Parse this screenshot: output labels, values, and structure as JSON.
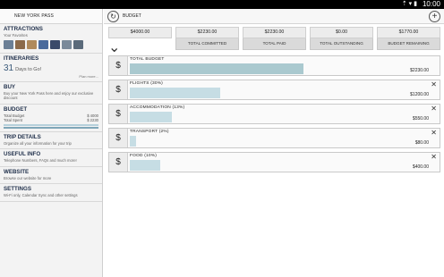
{
  "status": {
    "time": "10:00",
    "icons": "⇡ ▾ ▮"
  },
  "sidebar": {
    "header": "NEW YORK PASS",
    "attractions": {
      "title": "ATTRACTIONS",
      "sub": "Your Favorites"
    },
    "thumb_colors": [
      "#6b7f96",
      "#8c6a4a",
      "#b08a5c",
      "#4a6a9c",
      "#3a4a6a",
      "#7a8a9a",
      "#5a6a7a"
    ],
    "itineraries": {
      "title": "ITINERARIES",
      "days_num": "31",
      "days_text": "Days to Go!",
      "plan_more": "Plan more..."
    },
    "buy": {
      "title": "BUY",
      "sub": "Buy your New York Pass here and enjoy our exclusive discount"
    },
    "budget": {
      "title": "BUDGET",
      "total_budget_label": "Total Budget",
      "total_budget_value": "$ 4000",
      "total_spent_label": "Total Spent",
      "total_spent_value": "$ 2230"
    },
    "trip_details": {
      "title": "TRIP DETAILS",
      "sub": "Organize all your information for your trip"
    },
    "useful_info": {
      "title": "USEFUL INFO",
      "sub": "Telephone Numbers, FAQs and much more!"
    },
    "website": {
      "title": "WEBSITE",
      "sub": "Browse our website for more"
    },
    "settings": {
      "title": "SETTINGS",
      "sub": "Wi-Fi only, Calendar Sync and other settings"
    }
  },
  "topbar": {
    "title": "BUDGET",
    "back_icon": "back-icon",
    "add_icon": "add-icon"
  },
  "summary": [
    {
      "value": "$4000.00",
      "label": "TOTAL BUDGET",
      "dropdown": true
    },
    {
      "value": "$2230.00",
      "label": "TOTAL COMMITTED"
    },
    {
      "value": "$2230.00",
      "label": "TOTAL PAID"
    },
    {
      "value": "$0.00",
      "label": "TOTAL OUTSTANDING"
    },
    {
      "value": "$1770.00",
      "label": "BUDGET REMAINING"
    }
  ],
  "rows": [
    {
      "name": "TOTAL BUDGET",
      "amount": "$2230.00",
      "fraction": 0.575,
      "deletable": false,
      "total": true
    },
    {
      "name": "FLIGHTS  (30%)",
      "amount": "$1200.00",
      "fraction": 0.3,
      "deletable": true
    },
    {
      "name": "ACCOMMODATION  (13%)",
      "amount": "$550.00",
      "fraction": 0.14,
      "deletable": true
    },
    {
      "name": "TRANSPORT  (2%)",
      "amount": "$80.00",
      "fraction": 0.02,
      "deletable": true
    },
    {
      "name": "FOOD  (10%)",
      "amount": "$400.00",
      "fraction": 0.1,
      "deletable": true
    }
  ]
}
